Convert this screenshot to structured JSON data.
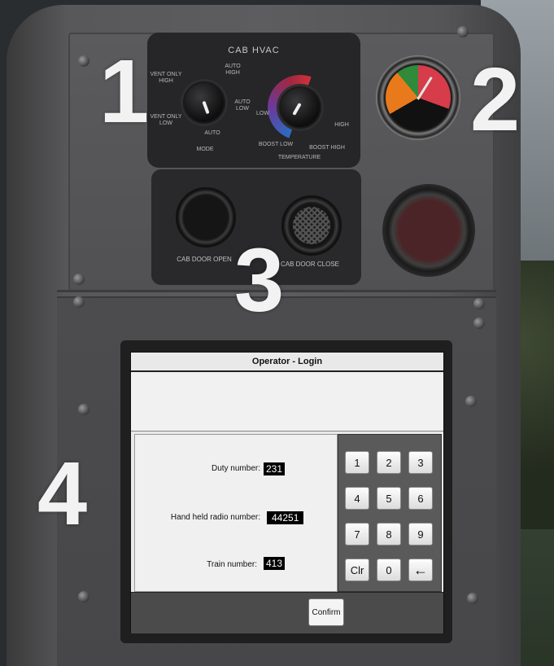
{
  "markers": {
    "m1": "1",
    "m2": "2",
    "m3": "3",
    "m4": "4"
  },
  "hvac": {
    "title": "CAB HVAC",
    "mode_label": "MODE",
    "temperature_label": "TEMPERATURE",
    "mode_options": {
      "vent_high": "VENT ONLY HIGH",
      "vent_low": "VENT ONLY LOW",
      "auto_high": "AUTO HIGH",
      "auto_low": "AUTO LOW",
      "auto": "AUTO"
    },
    "temp_options": {
      "low": "LOW",
      "high": "HIGH",
      "boost_low": "BOOST LOW",
      "boost_high": "BOOST HIGH"
    }
  },
  "doors": {
    "open_label": "CAB DOOR OPEN",
    "close_label": "CAB DOOR CLOSE"
  },
  "screen": {
    "title": "Operator - Login",
    "duty_label": "Duty number:",
    "duty_value": "231",
    "radio_label": "Hand held radio number:",
    "radio_value": "44251",
    "train_label": "Train number:",
    "train_value": "413",
    "keys": [
      "1",
      "2",
      "3",
      "4",
      "5",
      "6",
      "7",
      "8",
      "9",
      "Clr",
      "0",
      "←"
    ],
    "confirm_label": "Confirm"
  },
  "colors": {
    "gauge_red": "#d63c4a",
    "gauge_orange": "#e87a1c",
    "gauge_green": "#2f8a3a",
    "field_bg": "#000000"
  }
}
